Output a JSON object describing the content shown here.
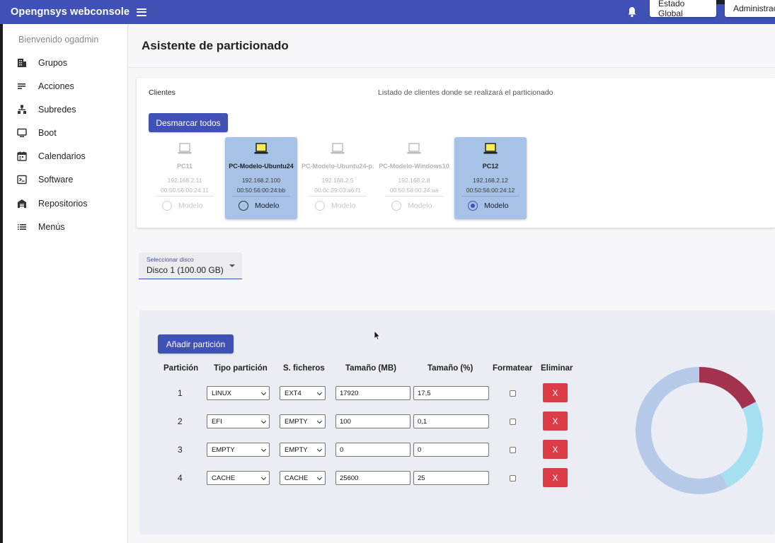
{
  "app": {
    "title": "Opengnsys webconsole"
  },
  "topbar": {
    "estado_label": "Estado Global",
    "admin_label": "Administrac"
  },
  "sidebar": {
    "welcome": "Bienvenido ogadmin",
    "items": [
      {
        "label": "Grupos",
        "icon": "building-icon"
      },
      {
        "label": "Acciones",
        "icon": "actions-list-icon"
      },
      {
        "label": "Subredes",
        "icon": "network-icon"
      },
      {
        "label": "Boot",
        "icon": "monitor-icon"
      },
      {
        "label": "Calendarios",
        "icon": "calendar-icon"
      },
      {
        "label": "Software",
        "icon": "terminal-icon"
      },
      {
        "label": "Repositorios",
        "icon": "warehouse-icon"
      },
      {
        "label": "Menús",
        "icon": "list-icon"
      }
    ]
  },
  "page": {
    "title": "Asistente de particionado"
  },
  "clients_section": {
    "label": "Clientes",
    "description": "Listado de clientes donde se realizará el particionado",
    "unmark_all_label": "Desmarcar todos",
    "radio_label": "Modelo",
    "clients": [
      {
        "name": "PC11",
        "ip": "192.168.2.11",
        "mac": "00:50:56:00:24:11",
        "selected": false,
        "model": false
      },
      {
        "name": "PC-Modelo-Ubuntu24",
        "ip": "192.168.2.100",
        "mac": "00:50:56:00:24:bb",
        "selected": true,
        "model": false
      },
      {
        "name": "PC-Modelo-Ubuntu24-p...",
        "ip": "192.168.2.5",
        "mac": "00:0c:29:03:a6:f1",
        "selected": false,
        "model": false
      },
      {
        "name": "PC-Modelo-Windows10",
        "ip": "192.168.2.8",
        "mac": "00:50:56:00:24:aa",
        "selected": false,
        "model": false
      },
      {
        "name": "PC12",
        "ip": "192.168.2.12",
        "mac": "00:50:56:00:24:12",
        "selected": true,
        "model": true
      }
    ]
  },
  "disk_select": {
    "label": "Seleccionar disco",
    "value": "Disco 1 (100.00 GB)"
  },
  "partitions": {
    "add_label": "Añadir partición",
    "headers": [
      "Partición",
      "Tipo partición",
      "S. ficheros",
      "Tamaño (MB)",
      "Tamaño (%)",
      "Formatear",
      "Eliminar"
    ],
    "delete_label": "X",
    "rows": [
      {
        "num": "1",
        "type": "LINUX",
        "fs": "EXT4",
        "size_mb": "17920",
        "size_pct": "17,5"
      },
      {
        "num": "2",
        "type": "EFI",
        "fs": "EMPTY",
        "size_mb": "100",
        "size_pct": "0,1"
      },
      {
        "num": "3",
        "type": "EMPTY",
        "fs": "EMPTY",
        "size_mb": "0",
        "size_pct": "0"
      },
      {
        "num": "4",
        "type": "CACHE",
        "fs": "CACHE",
        "size_mb": "25600",
        "size_pct": "25"
      }
    ]
  },
  "chart_data": {
    "type": "pie",
    "values": [
      17.5,
      0.1,
      0,
      25,
      57.4
    ],
    "colors": [
      "#a3324f",
      "#c9a6ff",
      "#cccccc",
      "#a6dff0",
      "#b5c9e8"
    ]
  },
  "colors": {
    "primary": "#3f51b5",
    "danger": "#dc3c45",
    "selected_card": "#a6c2e6"
  }
}
